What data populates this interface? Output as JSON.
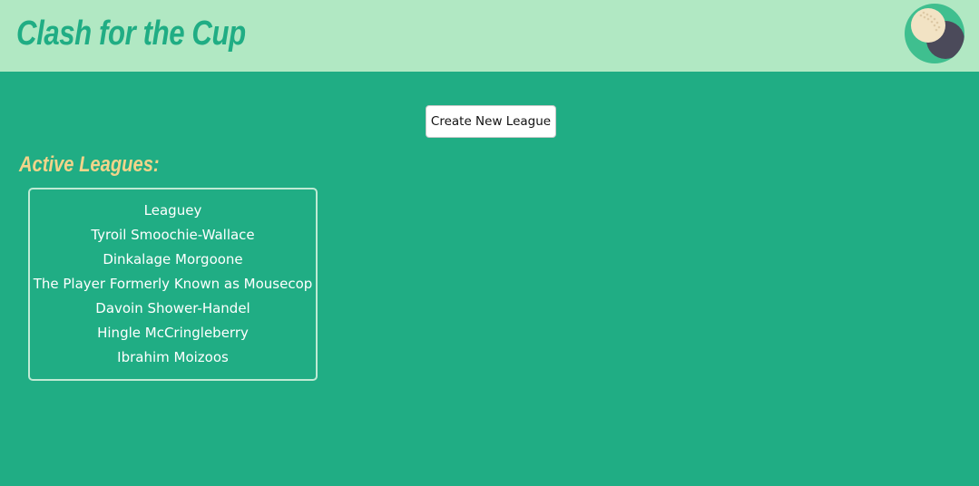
{
  "header": {
    "title": "Clash for the Cup",
    "avatar_icon": "cricket-ball-avatar-icon",
    "background_color": "#b1e8c3",
    "title_color": "#20ad84"
  },
  "main": {
    "background_color": "#20ad84",
    "create_button_label": "Create New League",
    "section_heading": "Active Leagues:",
    "heading_color": "#f2d48a",
    "leagues": [
      {
        "label": "Leaguey"
      },
      {
        "label": "Tyroil Smoochie-Wallace"
      },
      {
        "label": "Dinkalage Morgoone"
      },
      {
        "label": "The Player Formerly Known as Mousecop"
      },
      {
        "label": "Davoin Shower-Handel"
      },
      {
        "label": "Hingle McCringleberry"
      },
      {
        "label": "Ibrahim Moizoos"
      }
    ]
  }
}
